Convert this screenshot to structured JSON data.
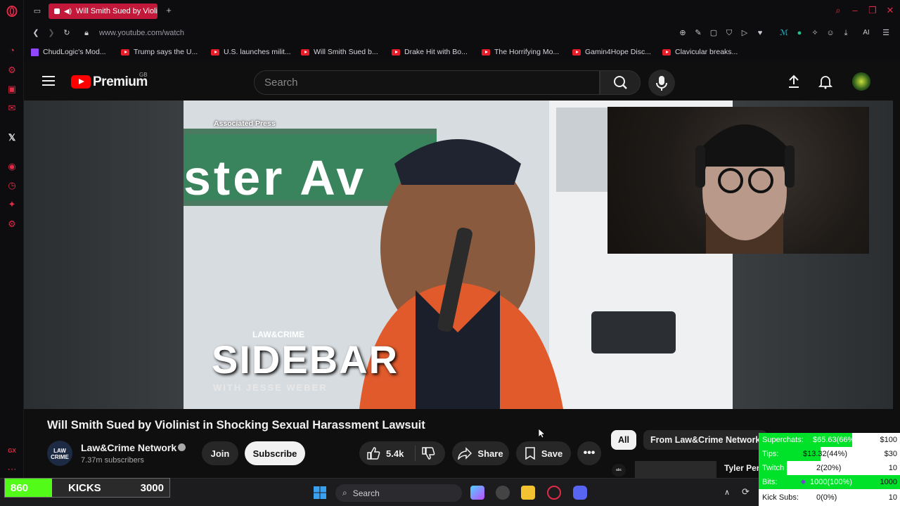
{
  "browser": {
    "active_tab_title": "Will Smith Sued by Violi",
    "url": "www.youtube.com/watch",
    "ai_label": "AI",
    "bookmarks": [
      {
        "label": "ChudLogic's Mod...",
        "icon": "twitch-icon"
      },
      {
        "label": "Trump says the U...",
        "icon": "youtube-icon"
      },
      {
        "label": "U.S. launches milit...",
        "icon": "youtube-icon"
      },
      {
        "label": "Will Smith Sued b...",
        "icon": "youtube-icon"
      },
      {
        "label": "Drake Hit with Bo...",
        "icon": "youtube-icon"
      },
      {
        "label": "The Horrifying Mo...",
        "icon": "youtube-icon"
      },
      {
        "label": "Gamin4Hope Disc...",
        "icon": "youtube-icon"
      },
      {
        "label": "Clavicular breaks...",
        "icon": "youtube-icon"
      }
    ],
    "sidebar_gx_label": "GX"
  },
  "youtube": {
    "logo_text": "Premium",
    "region": "GB",
    "search_placeholder": "Search",
    "video_overlay": {
      "source_credit": "Associated Press",
      "brand_top": "LAW&CRIME",
      "brand_main": "SIDEBAR",
      "brand_sub": "WITH JESSE WEBER",
      "street_sign": "ster Av"
    },
    "video_title": "Will Smith Sued by Violinist in Shocking Sexual Harassment Lawsuit",
    "channel": {
      "avatar_text": "LAW CRIME",
      "name": "Law&Crime Network",
      "subscribers": "7.37m subscribers",
      "join_label": "Join",
      "subscribe_label": "Subscribe"
    },
    "actions": {
      "likes": "5.4k",
      "share_label": "Share",
      "save_label": "Save"
    },
    "chips": [
      "All",
      "From Law&Crime Network"
    ],
    "recommended_partial": "Tyler Per",
    "recommended_badge": "abc NEWS"
  },
  "overlays": {
    "kicks": {
      "current": "860",
      "label": "KICKS",
      "goal": "3000",
      "progress": 0.287
    },
    "stats": [
      {
        "label": "Superchats:",
        "value": "$65.63(66%)",
        "goal": "$100",
        "fraction": 0.66
      },
      {
        "label": "Tips:",
        "value": "$13.32(44%)",
        "goal": "$30",
        "fraction": 0.44
      },
      {
        "label": "Twitch Subs:",
        "value": "2(20%)",
        "goal": "10",
        "fraction": 0.2
      },
      {
        "label": "Bits:",
        "value": "1000(100%)",
        "goal": "1000",
        "fraction": 1.0
      },
      {
        "label": "Kick Subs:",
        "value": "0(0%)",
        "goal": "10",
        "fraction": 0.0
      }
    ]
  },
  "taskbar": {
    "search_label": "Search"
  }
}
